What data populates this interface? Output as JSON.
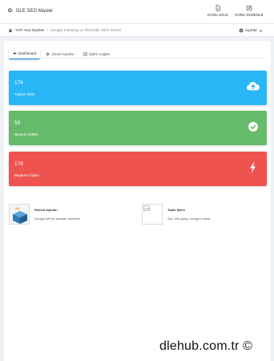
{
  "topbar": {
    "brand_letter": "G",
    "title": "DLE SEO Master",
    "actions": [
      {
        "label": "KONU EKLE",
        "icon": "file-icon"
      },
      {
        "label": "KONU DÜZENLE",
        "icon": "edit-icon"
      }
    ]
  },
  "breadcrumb": {
    "home": "YKP Ana Sayfası",
    "separator": "/",
    "current": "Google Indexing ve Otomatik SEO Paneli",
    "settings_label": "Ayarlar"
  },
  "tabs": [
    {
      "label": "Dashboard",
      "icon": "dashboard-icon",
      "active": true
    },
    {
      "label": "Genel Ayarlar",
      "icon": "gear-icon",
      "active": false
    },
    {
      "label": "İşlem Logları",
      "icon": "log-icon",
      "active": false
    }
  ],
  "stats": [
    {
      "value": "178",
      "label": "Toplam İstek",
      "color": "#29b6f6",
      "icon": "cloud-upload-icon"
    },
    {
      "value": "59",
      "label": "Başarılı İndeks",
      "color": "#66bb6a",
      "icon": "check-circle-icon"
    },
    {
      "value": "178",
      "label": "Başarısız İşlem",
      "color": "#ef5350",
      "icon": "bolt-icon"
    }
  ],
  "info": [
    {
      "title": "Eklenti Ayarları",
      "desc": "Google API'ye sunulan düzende."
    },
    {
      "title": "Toplu İşlem",
      "desc": "Son 100 yazıyı Google'a bildir."
    }
  ],
  "watermark": "dlehub.com.tr ©"
}
